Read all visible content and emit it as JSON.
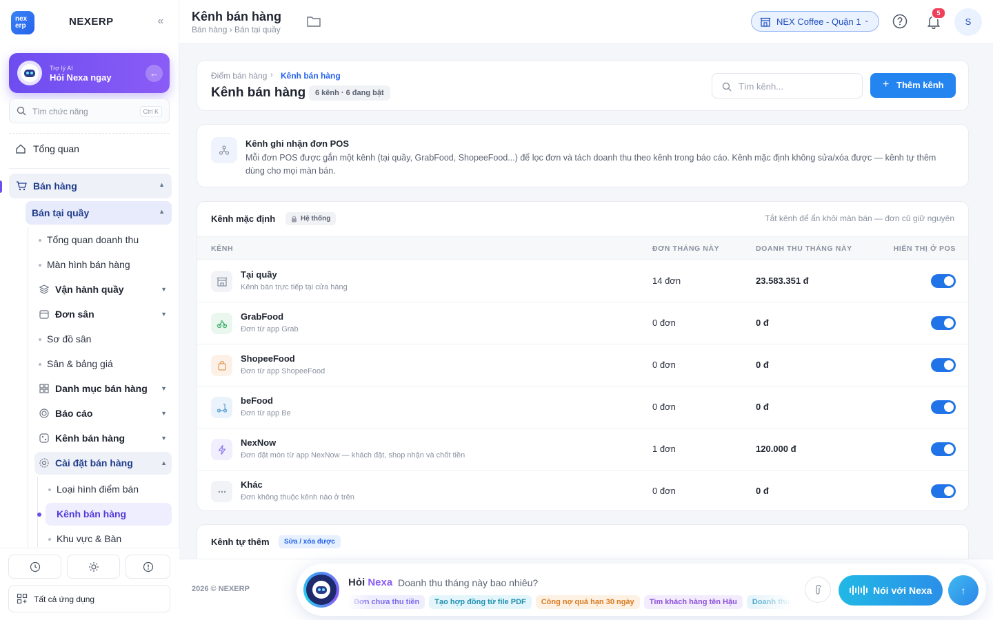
{
  "sidebar": {
    "brand": "NEXERP",
    "logo_text_1": "nex",
    "logo_text_2": "erp",
    "ai": {
      "sub": "Trợ lý AI",
      "main": "Hỏi Nexa ngay"
    },
    "search": {
      "placeholder": "Tìm chức năng",
      "shortcut": "Ctrl K"
    },
    "overview": "Tổng quan",
    "sales": "Bán hàng",
    "counter": "Bán tại quầy",
    "sub_items": [
      "Tổng quan doanh thu",
      "Màn hình bán hàng"
    ],
    "group_counter_ops": "Vận hành quầy",
    "group_court_orders": "Đơn sân",
    "court_items": [
      "Sơ đồ sân",
      "Sân & bảng giá"
    ],
    "groups": [
      "Danh mục bán hàng",
      "Báo cáo",
      "Kênh bán hàng"
    ],
    "settings": "Cài đặt bán hàng",
    "settings_items": [
      "Loại hình điểm bán",
      "Kênh bán hàng",
      "Khu vực & Bàn"
    ],
    "all_apps": "Tất cả ứng dụng"
  },
  "topbar": {
    "title": "Kênh bán hàng",
    "breadcrumb": "Bán hàng › Bán tại quầy",
    "store": "NEX Coffee - Quận 1",
    "notifications": "5",
    "avatar": "S"
  },
  "header": {
    "crumb_root": "Điểm bán hàng",
    "crumb_current": "Kênh bán hàng",
    "title": "Kênh bán hàng",
    "count": "6 kênh · 6 đang bật",
    "search_placeholder": "Tìm kênh...",
    "add_label": "Thêm kênh"
  },
  "info": {
    "title": "Kênh ghi nhận đơn POS",
    "desc": "Mỗi đơn POS được gắn một kênh (tại quầy, GrabFood, ShopeeFood...) để lọc đơn và tách doanh thu theo kênh trong báo cáo. Kênh mặc định không sửa/xóa được — kênh tự thêm dùng cho mọi màn bán."
  },
  "default_table": {
    "title": "Kênh mặc định",
    "badge": "Hệ thống",
    "note": "Tắt kênh để ẩn khỏi màn bán — đơn cũ giữ nguyên",
    "columns": [
      "KÊNH",
      "ĐƠN THÁNG NÀY",
      "DOANH THU THÁNG NÀY",
      "HIỂN THỊ Ở POS"
    ],
    "rows": [
      {
        "name": "Tại quầy",
        "desc": "Kênh bán trực tiếp tại cửa hàng",
        "orders": "14 đơn",
        "revenue": "23.583.351 đ",
        "visible": true,
        "icon": "store-icon",
        "bg": "#f1f3f6",
        "color": "#8a93a5"
      },
      {
        "name": "GrabFood",
        "desc": "Đơn từ app Grab",
        "orders": "0 đơn",
        "revenue": "0 đ",
        "visible": true,
        "icon": "bike-icon",
        "bg": "#eaf7ef",
        "color": "#3fae6a"
      },
      {
        "name": "ShopeeFood",
        "desc": "Đơn từ app ShopeeFood",
        "orders": "0 đơn",
        "revenue": "0 đ",
        "visible": true,
        "icon": "bag-icon",
        "bg": "#fdf1e7",
        "color": "#e49a5a"
      },
      {
        "name": "beFood",
        "desc": "Đơn từ app Be",
        "orders": "0 đơn",
        "revenue": "0 đ",
        "visible": true,
        "icon": "scooter-icon",
        "bg": "#eaf3fb",
        "color": "#5aa0d6"
      },
      {
        "name": "NexNow",
        "desc": "Đơn đặt món từ app NexNow — khách đặt, shop nhận và chốt tiền",
        "orders": "1 đơn",
        "revenue": "120.000 đ",
        "visible": true,
        "icon": "bolt-icon",
        "bg": "#f1effd",
        "color": "#8b7cf0"
      },
      {
        "name": "Khác",
        "desc": "Đơn không thuộc kênh nào ở trên",
        "orders": "0 đơn",
        "revenue": "0 đ",
        "visible": true,
        "icon": "more-icon",
        "bg": "#f1f3f6",
        "color": "#8a93a5"
      }
    ]
  },
  "custom_table": {
    "title": "Kênh tự thêm",
    "badge": "Sửa / xóa được"
  },
  "footer": {
    "copyright": "2026 © NEXERP",
    "ask_prefix": "Hỏi",
    "ask_name": "Nexa",
    "question": "Doanh thu tháng này bao nhiêu?",
    "chips": [
      {
        "label": "Đơn chưa thu tiền",
        "bg": "#efeefe",
        "color": "#7c6ae8"
      },
      {
        "label": "Tạo hợp đồng từ file PDF",
        "bg": "#e4f6fb",
        "color": "#1f8fb0"
      },
      {
        "label": "Công nợ quá hạn 30 ngày",
        "bg": "#fdf1e4",
        "color": "#d97a1e"
      },
      {
        "label": "Tìm khách hàng tên Hậu",
        "bg": "#f2ecfd",
        "color": "#8b4fd8"
      },
      {
        "label": "Doanh thu",
        "bg": "#e6f4fb",
        "color": "#3aa0c8"
      }
    ],
    "voice": "Nói với Nexa"
  },
  "colors": {
    "accent": "#2585f0",
    "purple": "#6d4df0",
    "toggle_on": "#2174e8"
  }
}
